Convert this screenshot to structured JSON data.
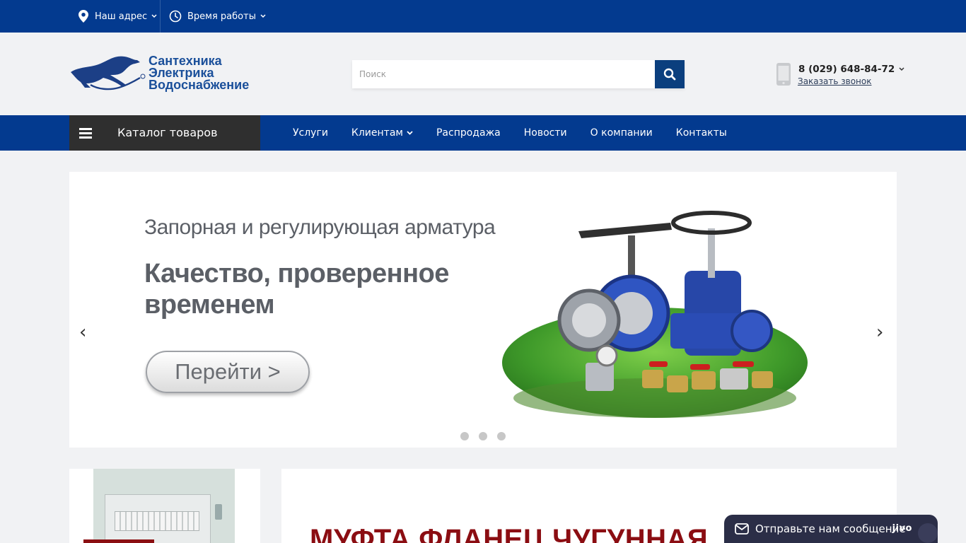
{
  "topbar": {
    "address_label": "Наш адрес",
    "hours_label": "Время работы"
  },
  "header": {
    "logo_lines": [
      "Сантехника",
      "Электрика",
      "Водоснабжение"
    ],
    "search_placeholder": "Поиск",
    "phone": "8 (029) 648-84-72",
    "callback_label": "Заказать звонок"
  },
  "nav": {
    "catalog_label": "Каталог товаров",
    "items": [
      "Услуги",
      "Клиентам",
      "Распродажа",
      "Новости",
      "О компании",
      "Контакты"
    ]
  },
  "slider": {
    "headline": "Запорная и регулирующая арматура",
    "subheadline": "Качество, проверенное временем",
    "cta_label": "Перейти  >",
    "prev_arrow": "‹",
    "next_arrow": "›",
    "slide_count": 3,
    "active_slide": 1
  },
  "promo": {
    "title": "МУФТА ФЛАНЕЦ ЧУГУННАЯ"
  },
  "chat": {
    "label": "Отправьте нам сообщение",
    "brand": "jivo"
  },
  "colors": {
    "brand_blue": "#033a8f",
    "catalog_dark": "#2f2f2f",
    "search_button": "#0b3f7e",
    "promo_red": "#8b0d12",
    "chat_bg": "#2b2e47"
  }
}
